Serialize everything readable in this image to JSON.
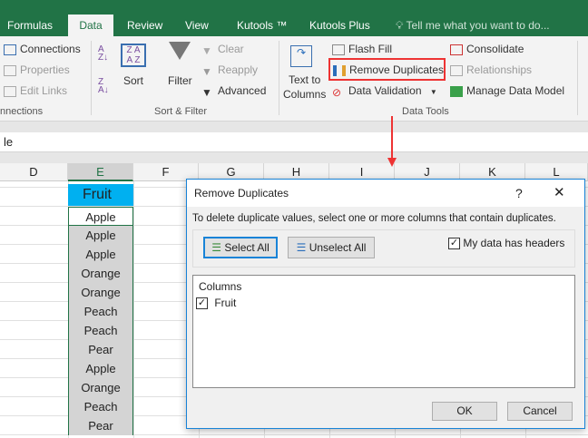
{
  "tabs": [
    "Formulas",
    "Data",
    "Review",
    "View",
    "Kutools ™",
    "Kutools Plus"
  ],
  "tell_me": "Tell me what you want to do...",
  "ribbon": {
    "connections": {
      "items": [
        "Connections",
        "Properties",
        "Edit Links"
      ],
      "group": "nnections"
    },
    "sort_filter": {
      "sort": "Sort",
      "filter": "Filter",
      "clear": "Clear",
      "reapply": "Reapply",
      "advanced": "Advanced",
      "group": "Sort & Filter"
    },
    "data_tools": {
      "text_to_columns": [
        "Text to",
        "Columns"
      ],
      "flash_fill": "Flash Fill",
      "remove_duplicates": "Remove Duplicates",
      "data_validation": "Data Validation",
      "consolidate": "Consolidate",
      "relationships": "Relationships",
      "manage_data_model": "Manage Data Model",
      "group": "Data Tools"
    }
  },
  "formula_bar": "le",
  "columns": [
    "D",
    "E",
    "F",
    "G",
    "H",
    "I",
    "J",
    "K",
    "L"
  ],
  "sheet": {
    "header": "Fruit",
    "values": [
      "Apple",
      "Apple",
      "Apple",
      "Orange",
      "Orange",
      "Peach",
      "Peach",
      "Pear",
      "Apple",
      "Orange",
      "Peach",
      "Pear"
    ]
  },
  "dialog": {
    "title": "Remove Duplicates",
    "help": "?",
    "close": "✕",
    "instruction": "To delete duplicate values, select one or more columns that contain duplicates.",
    "select_all": "Select All",
    "unselect_all": "Unselect All",
    "headers_label": "My data has headers",
    "headers_checked": true,
    "columns_label": "Columns",
    "column_items": [
      {
        "name": "Fruit",
        "checked": true
      }
    ],
    "ok": "OK",
    "cancel": "Cancel"
  },
  "colors": {
    "accent": "#217346",
    "highlight": "#ff0000",
    "header_fill": "#00b0f0"
  }
}
